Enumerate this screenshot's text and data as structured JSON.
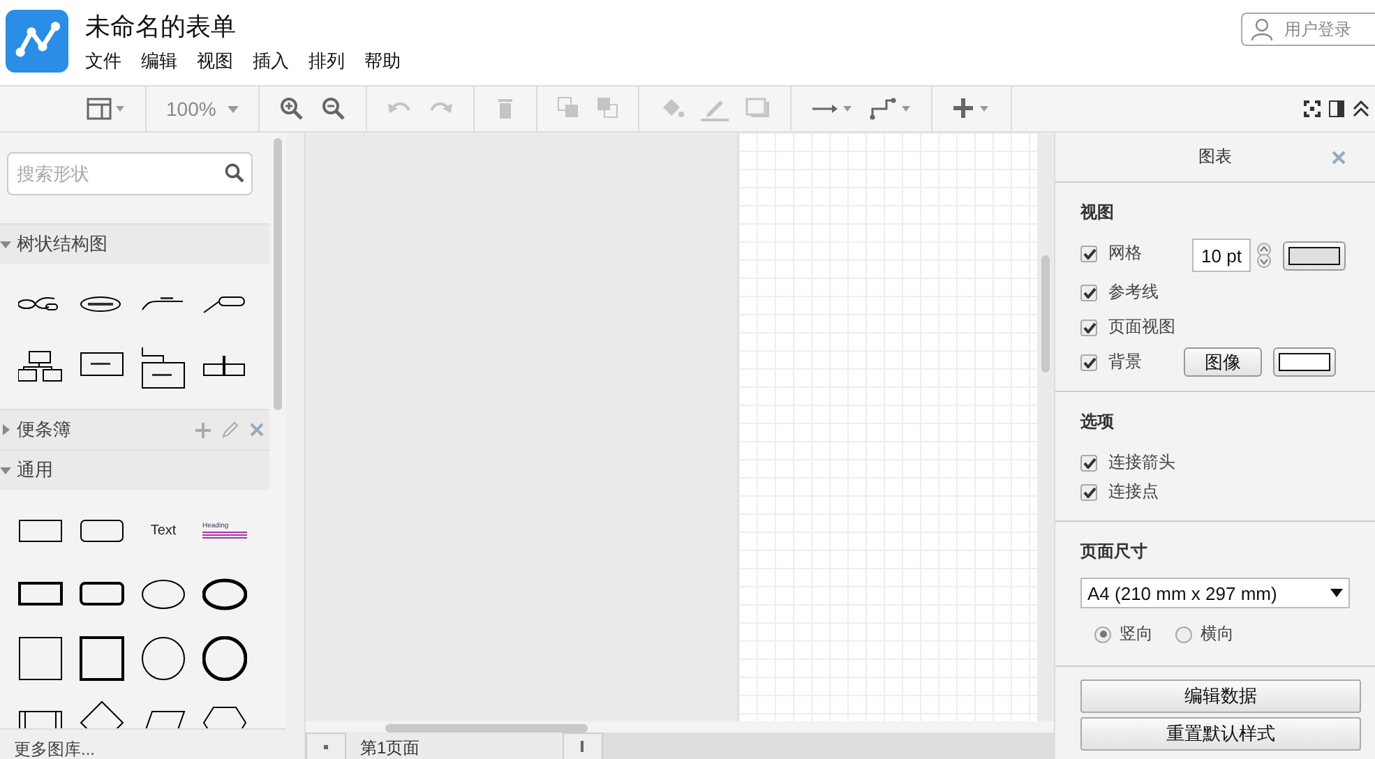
{
  "app": {
    "title": "未命名的表单",
    "menu": [
      "文件",
      "编辑",
      "视图",
      "插入",
      "排列",
      "帮助"
    ],
    "login": "用户登录"
  },
  "toolbar": {
    "zoom": "100%",
    "buttons": [
      {
        "disabled": false
      },
      {
        "disabled": false
      },
      {
        "disabled": false
      },
      {
        "disabled": true
      },
      {
        "disabled": true
      },
      {
        "disabled": true
      },
      {
        "disabled": true
      },
      {
        "disabled": true
      },
      {
        "disabled": true
      },
      {
        "disabled": true
      },
      {
        "disabled": true
      },
      {
        "disabled": false
      },
      {
        "disabled": false
      },
      {
        "disabled": false
      }
    ]
  },
  "sidebar": {
    "search": {
      "placeholder": "搜索形状"
    },
    "sections": [
      {
        "title": "树状结构图",
        "expanded": true,
        "kind": "tree"
      },
      {
        "title": "便条簿",
        "expanded": false,
        "kind": "scratch"
      },
      {
        "title": "通用",
        "expanded": true,
        "kind": "general",
        "labels": [
          "Text",
          "Heading"
        ]
      }
    ],
    "more": "更多图库..."
  },
  "pages": [
    {
      "label": "第1页面"
    }
  ],
  "panel": {
    "title": "图表",
    "view": {
      "heading": "视图",
      "options": [
        {
          "label": "网格",
          "checked": true
        },
        {
          "label": "参考线",
          "checked": true
        },
        {
          "label": "页面视图",
          "checked": true
        },
        {
          "label": "背景",
          "checked": true
        }
      ],
      "grid_size": "10 pt",
      "image_button": "图像"
    },
    "options": {
      "heading": "选项",
      "items": [
        {
          "label": "连接箭头",
          "checked": true
        },
        {
          "label": "连接点",
          "checked": true
        }
      ]
    },
    "page_size": {
      "heading": "页面尺寸",
      "value": "A4 (210 mm x 297 mm)",
      "orientation": [
        {
          "label": "竖向",
          "selected": true
        },
        {
          "label": "横向",
          "selected": false
        }
      ]
    },
    "buttons": [
      "编辑数据",
      "重置默认样式"
    ]
  }
}
